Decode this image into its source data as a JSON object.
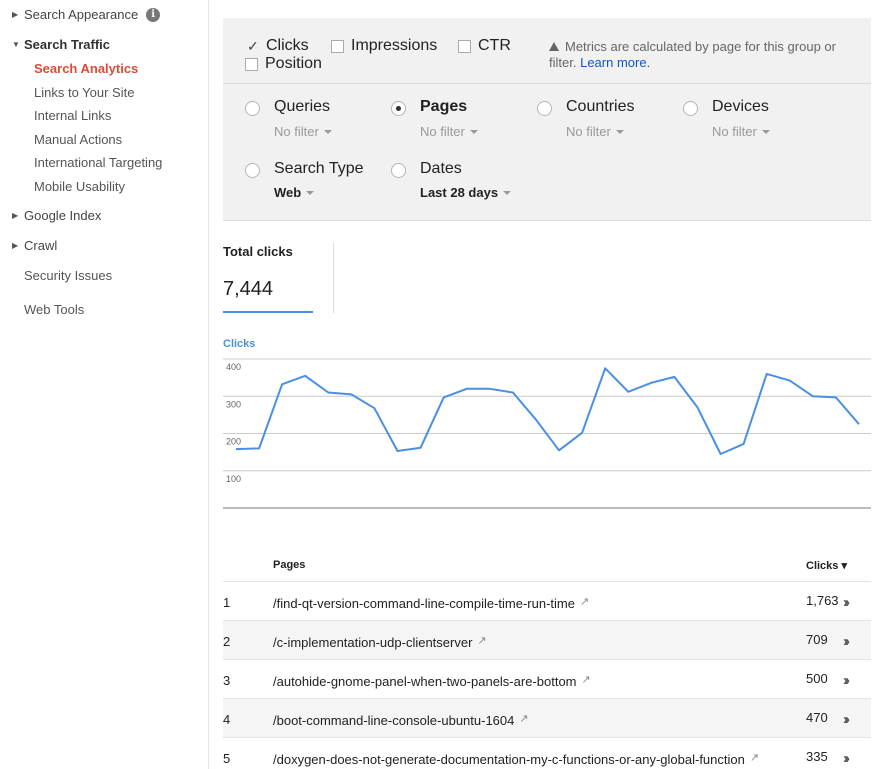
{
  "sidebar": {
    "search_appearance": "Search Appearance",
    "search_traffic": "Search Traffic",
    "sub_items": [
      "Search Analytics",
      "Links to Your Site",
      "Internal Links",
      "Manual Actions",
      "International Targeting",
      "Mobile Usability"
    ],
    "google_index": "Google Index",
    "crawl": "Crawl",
    "security_issues": "Security Issues",
    "web_tools": "Web Tools"
  },
  "metrics": {
    "clicks": "Clicks",
    "impressions": "Impressions",
    "ctr": "CTR",
    "position": "Position",
    "clicks_checked": true,
    "impressions_checked": false,
    "ctr_checked": false,
    "position_checked": false,
    "note": "Metrics are calculated by page for this group or filter.",
    "learn_more": "Learn more."
  },
  "dimensions": {
    "queries": {
      "label": "Queries",
      "filter": "No filter"
    },
    "pages": {
      "label": "Pages",
      "filter": "No filter"
    },
    "countries": {
      "label": "Countries",
      "filter": "No filter"
    },
    "devices": {
      "label": "Devices",
      "filter": "No filter"
    },
    "search_type": {
      "label": "Search Type",
      "filter": "Web"
    },
    "dates": {
      "label": "Dates",
      "filter": "Last 28 days"
    },
    "selected": "Pages"
  },
  "totals": {
    "label": "Total clicks",
    "value": "7,444"
  },
  "chart_data": {
    "type": "line",
    "title": "Clicks",
    "y_ticks": [
      "400",
      "300",
      "200",
      "100"
    ],
    "ylim": [
      0,
      400
    ],
    "grid": true,
    "color": "#4a90e2",
    "values": [
      158,
      160,
      332,
      355,
      310,
      305,
      268,
      153,
      162,
      297,
      320,
      320,
      310,
      237,
      155,
      202,
      375,
      312,
      336,
      352,
      270,
      145,
      172,
      360,
      342,
      300,
      297,
      225
    ]
  },
  "table": {
    "col_pages": "Pages",
    "col_clicks": "Clicks ▾",
    "rows": [
      {
        "rank": "1",
        "page": "/find-qt-version-command-line-compile-time-run-time",
        "clicks": "1,763"
      },
      {
        "rank": "2",
        "page": "/c-implementation-udp-clientserver",
        "clicks": "709"
      },
      {
        "rank": "3",
        "page": "/autohide-gnome-panel-when-two-panels-are-bottom",
        "clicks": "500"
      },
      {
        "rank": "4",
        "page": "/boot-command-line-console-ubuntu-1604",
        "clicks": "470"
      },
      {
        "rank": "5",
        "page": "/doxygen-does-not-generate-documentation-my-c-functions-or-any-global-function",
        "clicks": "335"
      }
    ]
  }
}
